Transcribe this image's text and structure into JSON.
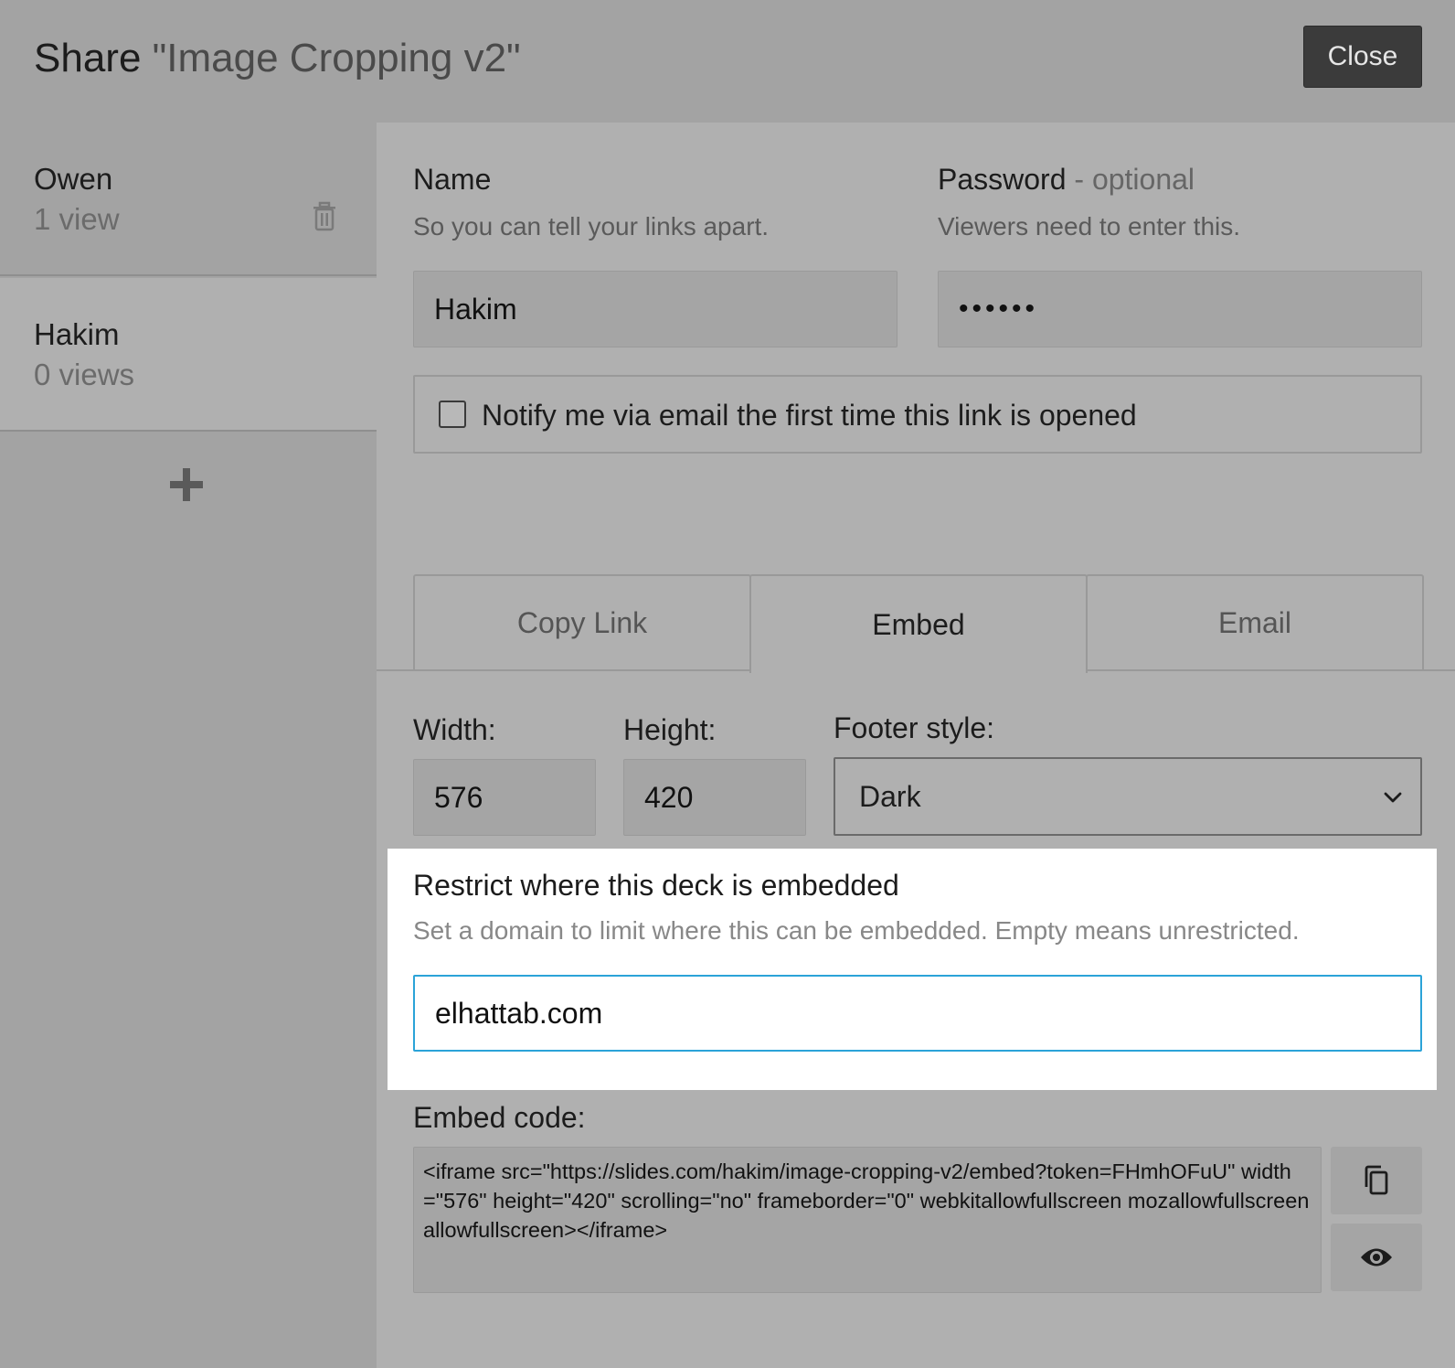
{
  "header": {
    "share_label": "Share",
    "deck_title": "\"Image Cropping v2\"",
    "close_label": "Close"
  },
  "sidebar": {
    "links": [
      {
        "name": "Owen",
        "views": "1 view"
      },
      {
        "name": "Hakim",
        "views": "0 views"
      }
    ],
    "add_icon": "plus-icon",
    "delete_icon": "trash-icon"
  },
  "form": {
    "name_label": "Name",
    "name_hint": "So you can tell your links apart.",
    "name_value": "Hakim",
    "password_label": "Password",
    "password_optional": "- optional",
    "password_hint": "Viewers need to enter this.",
    "password_value": "••••••",
    "notify_label": "Notify me via email the first time this link is opened",
    "notify_checked": false
  },
  "tabs": [
    {
      "label": "Copy Link",
      "active": false
    },
    {
      "label": "Embed",
      "active": true
    },
    {
      "label": "Email",
      "active": false
    }
  ],
  "embed": {
    "width_label": "Width:",
    "width_value": "576",
    "height_label": "Height:",
    "height_value": "420",
    "footer_label": "Footer style:",
    "footer_value": "Dark",
    "restrict_title": "Restrict where this deck is embedded",
    "restrict_hint": "Set a domain to limit where this can be embedded. Empty means unrestricted.",
    "domain_value": "elhattab.com",
    "code_label": "Embed code:",
    "code_value": "<iframe src=\"https://slides.com/hakim/image-cropping-v2/embed?token=FHmhOFuU\" width=\"576\" height=\"420\" scrolling=\"no\" frameborder=\"0\" webkitallowfullscreen mozallowfullscreen allowfullscreen></iframe>",
    "copy_icon": "copy-icon",
    "preview_icon": "eye-icon"
  },
  "colors": {
    "accent_focus": "#2ba3d8",
    "close_button": "#3b3b3b"
  }
}
